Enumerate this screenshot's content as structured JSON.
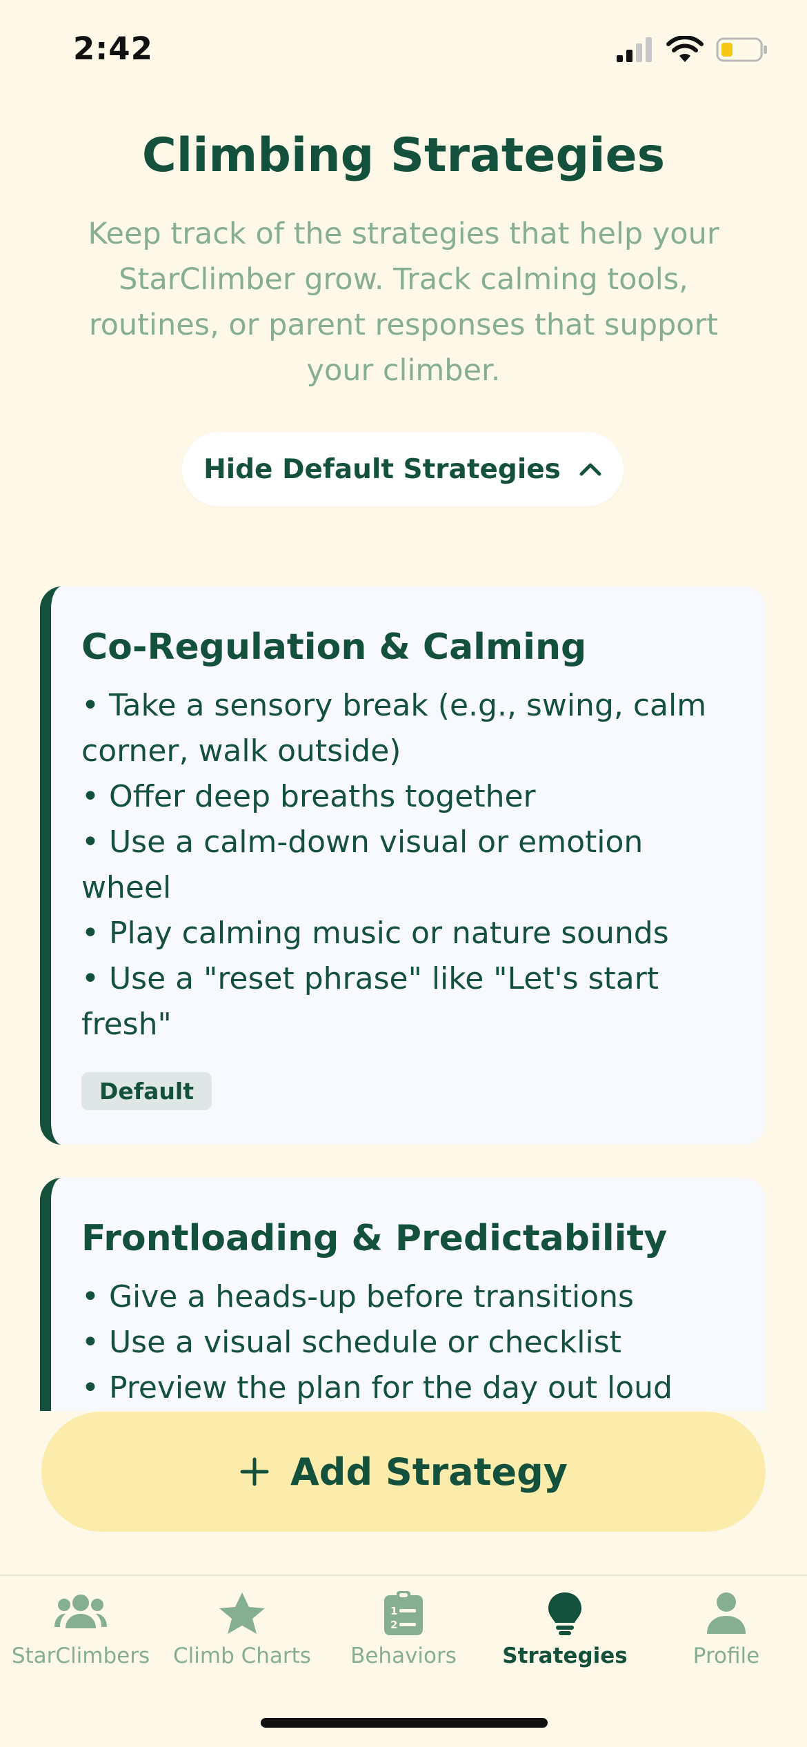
{
  "status_bar": {
    "time": "2:42"
  },
  "header": {
    "title": "Climbing Strategies",
    "subtitle": "Keep track of the strategies that help your StarClimber grow. Track calming tools, routines, or parent responses that support your climber."
  },
  "toggle": {
    "label": "Hide Default Strategies",
    "icon": "chevron-up-icon"
  },
  "strategies": [
    {
      "title": "Co-Regulation & Calming",
      "body": "• Take a sensory break (e.g., swing, calm corner, walk outside)\n• Offer deep breaths together\n• Use a calm-down visual or emotion wheel\n• Play calming music or nature sounds\n• Use a \"reset phrase\" like \"Let's start fresh\"",
      "badge": "Default"
    },
    {
      "title": "Frontloading & Predictability",
      "body": "• Give a heads-up before transitions\n• Use a visual schedule or checklist\n• Preview the plan for the day out loud"
    }
  ],
  "add_button": {
    "icon": "plus-icon",
    "label": "Add Strategy"
  },
  "tab_bar": {
    "items": [
      {
        "label": "StarClimbers",
        "icon": "people-icon",
        "active": false
      },
      {
        "label": "Climb Charts",
        "icon": "star-icon",
        "active": false
      },
      {
        "label": "Behaviors",
        "icon": "clipboard-list-icon",
        "active": false
      },
      {
        "label": "Strategies",
        "icon": "lightbulb-icon",
        "active": true
      },
      {
        "label": "Profile",
        "icon": "person-icon",
        "active": false
      }
    ]
  },
  "colors": {
    "background": "#FEF8E8",
    "primary": "#14513D",
    "muted": "#86AE90",
    "card": "#F8F9FF",
    "accent_button": "#FBECAC"
  }
}
